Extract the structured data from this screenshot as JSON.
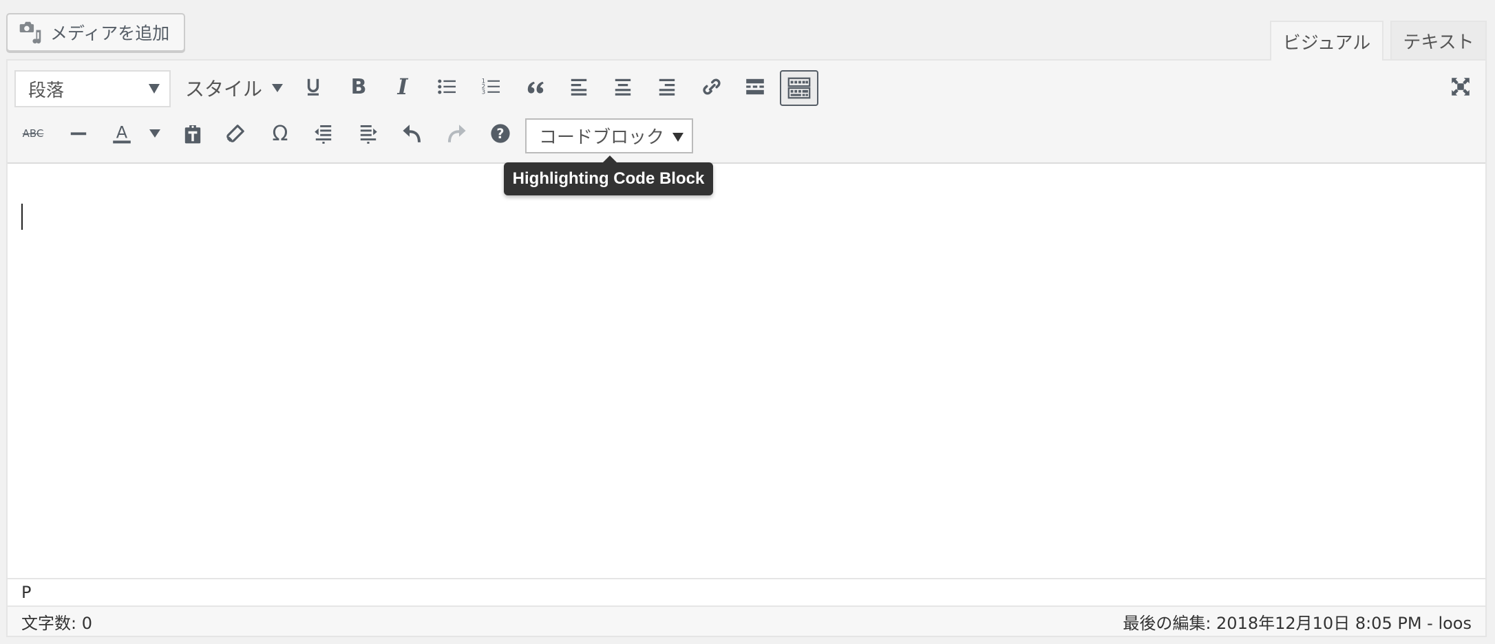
{
  "media_button": {
    "label": "メディアを追加",
    "icon": "camera-music-icon"
  },
  "tabs": [
    {
      "label": "ビジュアル",
      "active": true
    },
    {
      "label": "テキスト",
      "active": false
    }
  ],
  "toolbar": {
    "format_select": {
      "value": "段落"
    },
    "styles_label": "スタイル",
    "row1": [
      "underline",
      "bold",
      "italic",
      "bullet-list",
      "numbered-list",
      "blockquote",
      "align-left",
      "align-center",
      "align-right",
      "link",
      "read-more",
      "code-toolbar-toggle"
    ],
    "row2": [
      "strikethrough",
      "horizontal-rule",
      "text-color",
      "paste-as-text",
      "clear-formatting",
      "special-character",
      "outdent",
      "indent",
      "undo",
      "redo",
      "keyboard-shortcuts"
    ],
    "code_select": {
      "value": "コードブロック"
    },
    "fullscreen": "fullscreen-icon",
    "redo_disabled": true
  },
  "tooltip": {
    "text": "Highlighting Code Block"
  },
  "editor": {
    "content": ""
  },
  "path_bar": {
    "path": "P"
  },
  "status_bar": {
    "word_count": "文字数: 0",
    "last_edited": "最後の編集: 2018年12月10日 8:05 PM - loos"
  },
  "colors": {
    "icon": "#555d66",
    "tooltip_bg": "#333333",
    "toolbar_bg": "#f5f5f5",
    "page_bg": "#f1f1f1"
  }
}
